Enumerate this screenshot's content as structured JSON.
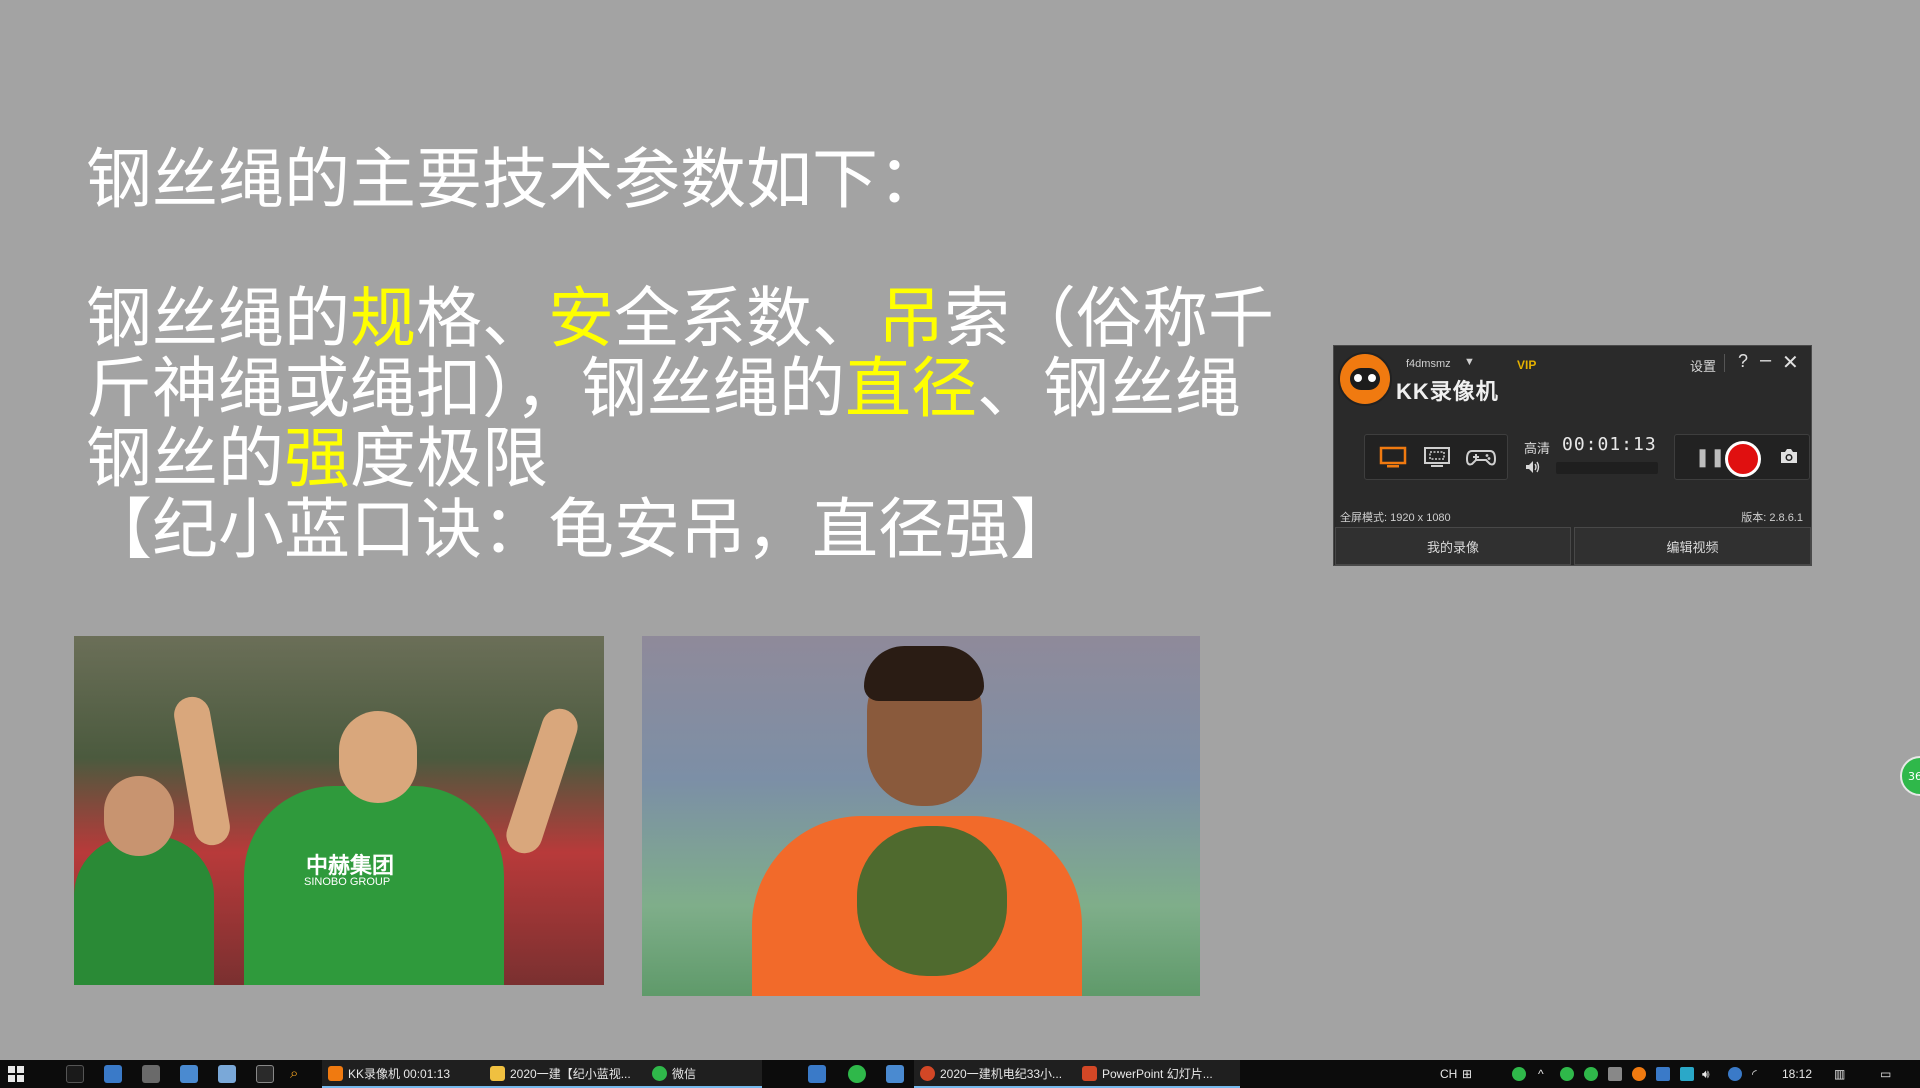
{
  "slide": {
    "title": "钢丝绳的主要技术参数如下：",
    "body": [
      [
        {
          "t": "钢丝绳的",
          "hl": false
        },
        {
          "t": "规",
          "hl": true
        },
        {
          "t": "格、",
          "hl": false
        },
        {
          "t": "安",
          "hl": true
        },
        {
          "t": "全系数、",
          "hl": false
        },
        {
          "t": "吊",
          "hl": true
        },
        {
          "t": "索（俗称千",
          "hl": false
        }
      ],
      [
        {
          "t": "斤神绳或绳扣），钢丝绳的",
          "hl": false
        },
        {
          "t": "直径",
          "hl": true
        },
        {
          "t": "、钢丝绳",
          "hl": false
        }
      ],
      [
        {
          "t": "钢丝的",
          "hl": false
        },
        {
          "t": "强",
          "hl": true
        },
        {
          "t": "度极限",
          "hl": false
        }
      ]
    ],
    "mnemonic": "【纪小蓝口诀：龟安吊，直径强】",
    "highlight_color": "#ffff00",
    "text_color": "#ffffff",
    "background_color": "#a3a3a3"
  },
  "photo_left": {
    "jersey_text_1": "中赫集团",
    "jersey_text_2": "SINOBO GROUP"
  },
  "kk": {
    "username": "f4dmsmz",
    "vip": "VIP",
    "title": "KK录像机",
    "settings": "设置",
    "help": "?",
    "minimize": "–",
    "close": "✕",
    "quality": "高清",
    "timer": "00:01:13",
    "mode_text": "全屏模式: 1920 x 1080",
    "version": "版本: 2.8.6.1",
    "my_recordings": "我的录像",
    "edit_video": "编辑视频"
  },
  "side_bubble": {
    "text": "36"
  },
  "taskbar": {
    "apps": [
      {
        "label": "KK录像机 00:01:13",
        "color": "#f07a10"
      },
      {
        "label": "2020一建【纪小蓝视...",
        "color": "#f0c040"
      },
      {
        "label": "微信",
        "color": "#2fb84a"
      },
      {
        "label": "2020一建机电纪33小...",
        "color": "#d24726"
      },
      {
        "label": "PowerPoint 幻灯片...",
        "color": "#d24726"
      }
    ],
    "ime": "CH",
    "clock": "18:12"
  }
}
